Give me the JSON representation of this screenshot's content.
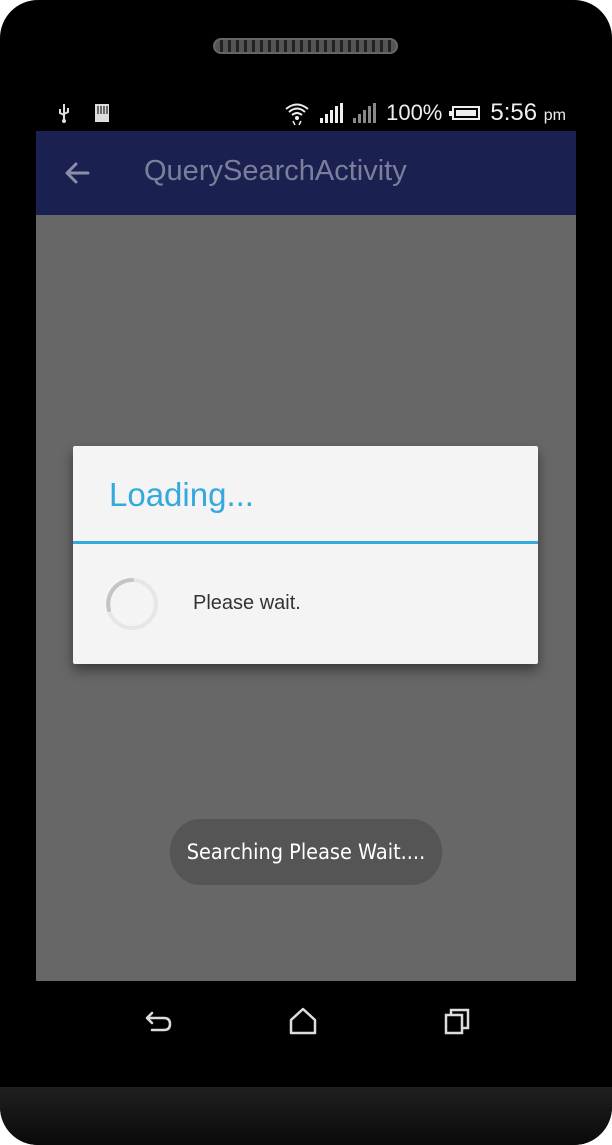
{
  "status_bar": {
    "battery_percent": "100%",
    "time": "5:56",
    "time_suffix": "pm",
    "icons": [
      "usb-icon",
      "sd-card-icon",
      "wifi-icon",
      "signal-icon",
      "signal-secondary-icon",
      "battery-icon"
    ]
  },
  "app_bar": {
    "title": "QuerySearchActivity",
    "back_icon": "back-arrow-icon",
    "background_color": "#1a2050"
  },
  "dialog": {
    "title": "Loading...",
    "message": "Please wait.",
    "accent_color": "#33a9dc"
  },
  "toast": {
    "text": "Searching Please Wait...."
  },
  "nav_bar": {
    "buttons": [
      "back-nav-icon",
      "home-nav-icon",
      "recents-nav-icon"
    ]
  }
}
